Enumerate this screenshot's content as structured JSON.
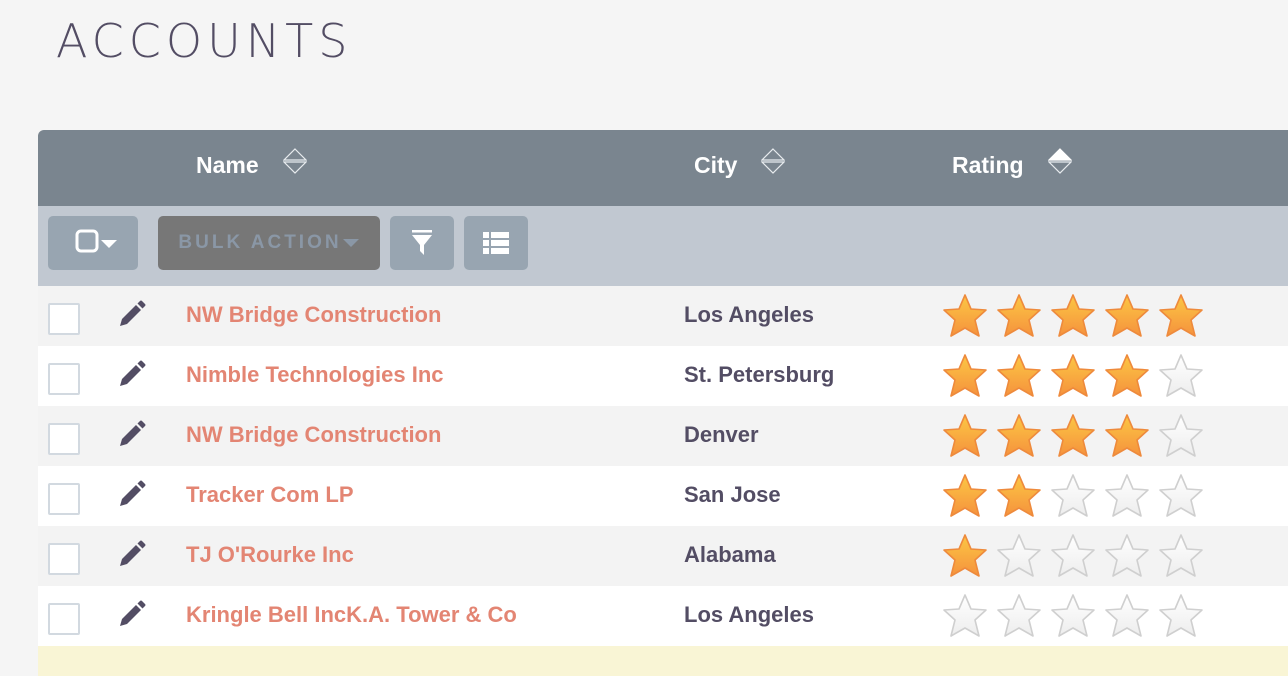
{
  "page": {
    "title": "ACCOUNTS"
  },
  "table": {
    "columns": [
      {
        "label": "Name",
        "sort": "none"
      },
      {
        "label": "City",
        "sort": "none"
      },
      {
        "label": "Rating",
        "sort": "ascending"
      }
    ],
    "toolbar": {
      "select_icon": "checkbox-dropdown-icon",
      "bulk_action_label": "BULK ACTION",
      "filter_icon": "filter-icon",
      "columns_icon": "list-icon"
    },
    "max_rating": 5,
    "rows": [
      {
        "name": "NW Bridge Construction",
        "city": "Los Angeles",
        "rating": 5
      },
      {
        "name": "Nimble Technologies Inc",
        "city": "St. Petersburg",
        "rating": 4
      },
      {
        "name": "NW Bridge Construction",
        "city": "Denver",
        "rating": 4
      },
      {
        "name": "Tracker Com LP",
        "city": "San Jose",
        "rating": 2
      },
      {
        "name": "TJ O'Rourke Inc",
        "city": "Alabama",
        "rating": 1
      },
      {
        "name": "Kringle Bell IncK.A. Tower & Co",
        "city": "Los Angeles",
        "rating": 0
      }
    ]
  },
  "colors": {
    "header_bg": "#7a858f",
    "toolbar_bg": "#c1c8d1",
    "link": "#e38573",
    "star_filled": "#f7a23c",
    "highlight_row": "#f9f5d5"
  }
}
